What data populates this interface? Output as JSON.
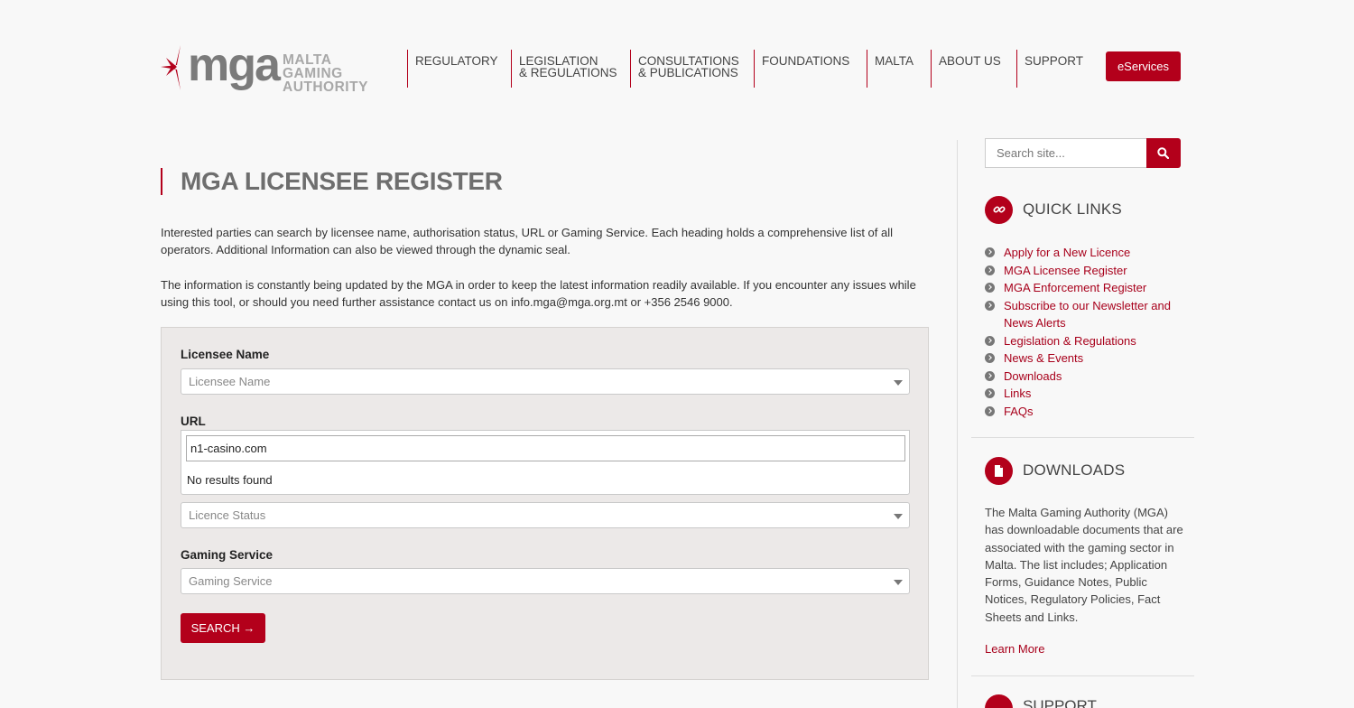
{
  "brand": {
    "logo_word": "mga",
    "logo_sub_line1": "MALTA GAMING",
    "logo_sub_line2": "AUTHORITY",
    "accent_color": "#b3001b"
  },
  "nav": {
    "items": [
      {
        "label": "REGULATORY"
      },
      {
        "label": "LEGISLATION\n& REGULATIONS"
      },
      {
        "label": "CONSULTATIONS\n& PUBLICATIONS"
      },
      {
        "label": "FOUNDATIONS"
      },
      {
        "label": "MALTA"
      },
      {
        "label": "ABOUT US"
      },
      {
        "label": "SUPPORT"
      }
    ],
    "eservices_label": "eServices"
  },
  "main": {
    "title": "MGA LICENSEE REGISTER",
    "intro_p1": "Interested parties can search by licensee name, authorisation status, URL or Gaming Service. Each heading holds a comprehensive list of all operators. Additional Information can also be viewed through the dynamic seal.",
    "intro_p2": "The information is constantly being updated by the MGA in order to keep the latest information readily available. If you encounter any issues while using this tool, or should you need further assistance contact us on info.mga@mga.org.mt or +356 2546 9000."
  },
  "form": {
    "licensee_label": "Licensee Name",
    "licensee_placeholder": "Licensee Name",
    "url_label": "URL",
    "url_value": "n1-casino.com",
    "url_no_results": "No results found",
    "status_placeholder": "Licence Status",
    "gaming_label": "Gaming Service",
    "gaming_placeholder": "Gaming Service",
    "search_label": "SEARCH →"
  },
  "sidebar": {
    "search_placeholder": "Search site...",
    "quick_links_title": "QUICK LINKS",
    "quick_links": [
      "Apply for a New Licence",
      "MGA Licensee Register",
      "MGA Enforcement Register",
      "Subscribe to our Newsletter and News Alerts",
      "Legislation & Regulations",
      "News & Events",
      "Downloads",
      "Links",
      "FAQs"
    ],
    "downloads_title": "DOWNLOADS",
    "downloads_text": "The Malta Gaming Authority (MGA) has downloadable documents that are associated with the gaming sector in Malta. The list includes; Application Forms, Guidance Notes, Public Notices, Regulatory Policies, Fact Sheets and Links.",
    "learn_more": "Learn More",
    "support_title": "SUPPORT"
  }
}
